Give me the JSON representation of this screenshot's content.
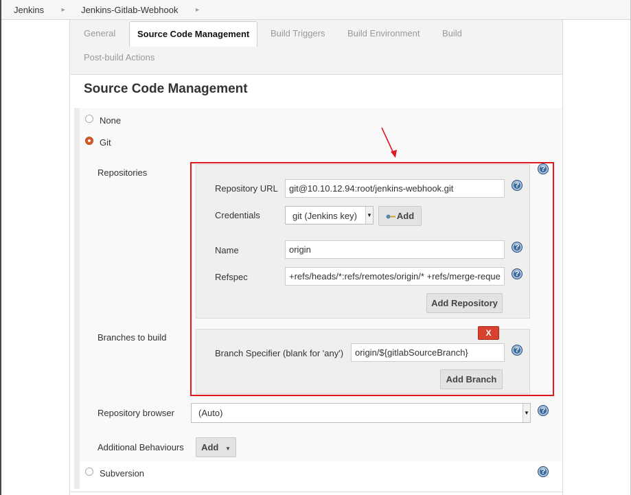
{
  "breadcrumb": [
    "Jenkins",
    "Jenkins-Gitlab-Webhook"
  ],
  "tabs": {
    "general": "General",
    "scm": "Source Code Management",
    "triggers": "Build Triggers",
    "environment": "Build Environment",
    "build": "Build",
    "post": "Post-build Actions"
  },
  "section_title": "Source Code Management",
  "scm_options": {
    "none": "None",
    "git": "Git",
    "subversion": "Subversion"
  },
  "selected_scm": "Git",
  "repositories": {
    "label": "Repositories",
    "url_label": "Repository URL",
    "url_value": "git@10.10.12.94:root/jenkins-webhook.git",
    "credentials_label": "Credentials",
    "credentials_value": "git (Jenkins key)",
    "add_label": "Add",
    "name_label": "Name",
    "name_value": "origin",
    "refspec_label": "Refspec",
    "refspec_value": "+refs/heads/*:refs/remotes/origin/* +refs/merge-reque",
    "add_repository": "Add Repository"
  },
  "branches": {
    "label": "Branches to build",
    "delete_label": "X",
    "specifier_label": "Branch Specifier (blank for 'any')",
    "specifier_value": "origin/${gitlabSourceBranch}",
    "add_branch": "Add Branch"
  },
  "repo_browser": {
    "label": "Repository browser",
    "value": "(Auto)"
  },
  "additional": {
    "label": "Additional Behaviours",
    "add": "Add"
  },
  "help_glyph": "?",
  "colors": {
    "highlight": "#e0171f",
    "radio_checked": "#d35a26",
    "help": "#3f6b9c"
  }
}
